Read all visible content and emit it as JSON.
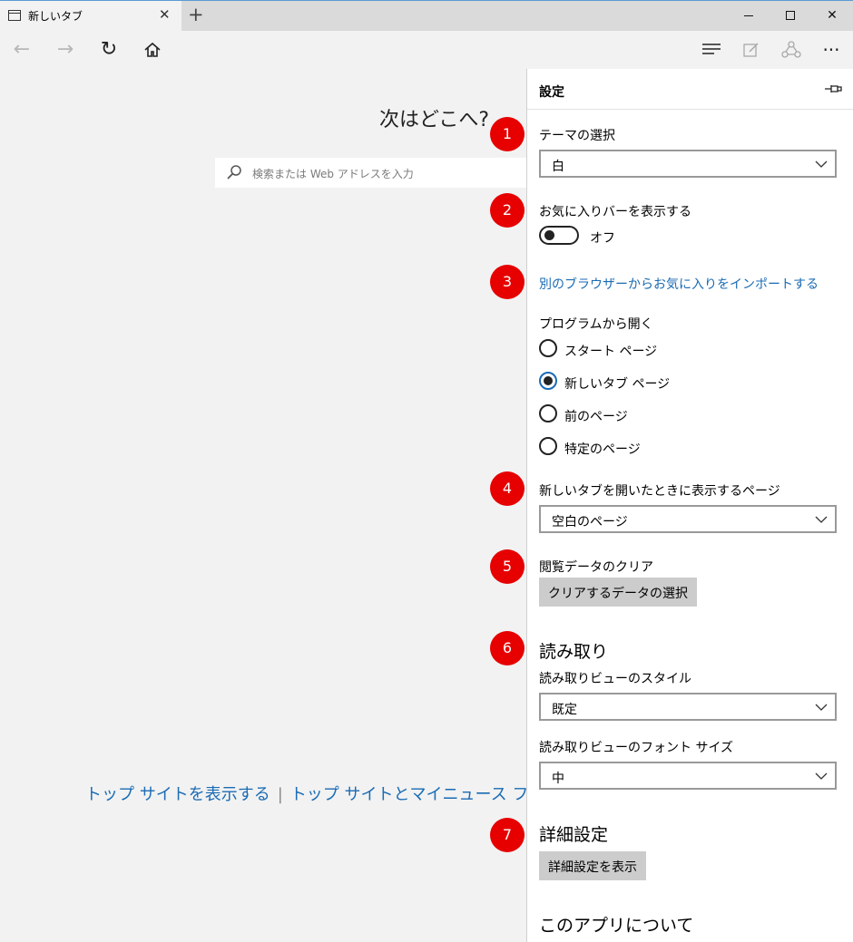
{
  "tab": {
    "title": "新しいタブ",
    "close": "✕",
    "new_tab": "+"
  },
  "window": {
    "close": "✕"
  },
  "toolbar": {
    "back": "←",
    "forward": "→",
    "refresh": "↻",
    "more": "···"
  },
  "main": {
    "heading": "次はどこへ?",
    "search_placeholder": "検索または Web アドレスを入力",
    "link_top_sites": "トップ サイトを表示する",
    "link_separator": "|",
    "link_top_sites_news": "トップ サイトとマイニュース フィード"
  },
  "settings": {
    "title": "設定",
    "theme_label": "テーマの選択",
    "theme_value": "白",
    "favorites_bar_label": "お気に入りバーを表示する",
    "favorites_bar_state": "オフ",
    "import_link": "別のブラウザーからお気に入りをインポートする",
    "open_with_label": "プログラムから開く",
    "open_with_options": [
      "スタート ページ",
      "新しいタブ ページ",
      "前のページ",
      "特定のページ"
    ],
    "open_with_selected": "新しいタブ ページ",
    "new_tab_label": "新しいタブを開いたときに表示するページ",
    "new_tab_value": "空白のページ",
    "clear_data_label": "閲覧データのクリア",
    "clear_data_button": "クリアするデータの選択",
    "reading_section": "読み取り",
    "reading_style_label": "読み取りビューのスタイル",
    "reading_style_value": "既定",
    "reading_font_label": "読み取りビューのフォント サイズ",
    "reading_font_value": "中",
    "advanced_section": "詳細設定",
    "advanced_button": "詳細設定を表示",
    "about_section": "このアプリについて"
  },
  "markers": [
    "1",
    "2",
    "3",
    "4",
    "5",
    "6",
    "7"
  ],
  "colors": {
    "marker": "#e60000",
    "link": "#1a6bb4",
    "accent": "#1a6bb4"
  }
}
